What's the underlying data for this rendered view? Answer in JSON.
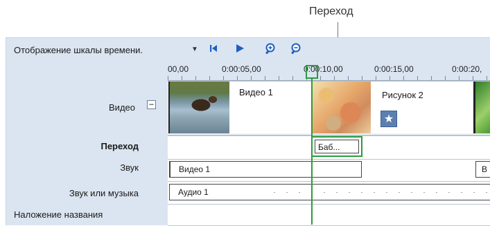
{
  "callout": {
    "label": "Переход"
  },
  "toolbar": {
    "title": "Отображение шкалы времени.",
    "dropdown_icon": "triangle-down-icon",
    "prev_icon": "skip-back-icon",
    "play_icon": "play-icon",
    "zoom_in_icon": "zoom-in-icon",
    "zoom_out_icon": "zoom-out-icon"
  },
  "ruler": {
    "labels": [
      "00,00",
      "0:00:05,00",
      "0:00:10,00",
      "0:00:15,00",
      "0:00:20,"
    ]
  },
  "tracks": {
    "video": "Видео",
    "collapse_symbol": "−",
    "transition": "Переход",
    "sound": "Звук",
    "music": "Звук или музыка",
    "overlay": "Наложение названия"
  },
  "clips": {
    "video1": "Видео 1",
    "picture2": "Рисунок 2",
    "transition": "Баб...",
    "sound1": "Видео 1",
    "sound2": "В",
    "audio1": "Аудио 1",
    "star_glyph": "★"
  },
  "colors": {
    "panel_bg": "#dbe5f1",
    "accent_blue": "#1f5fbf",
    "playhead_green": "#2b9b3c"
  }
}
